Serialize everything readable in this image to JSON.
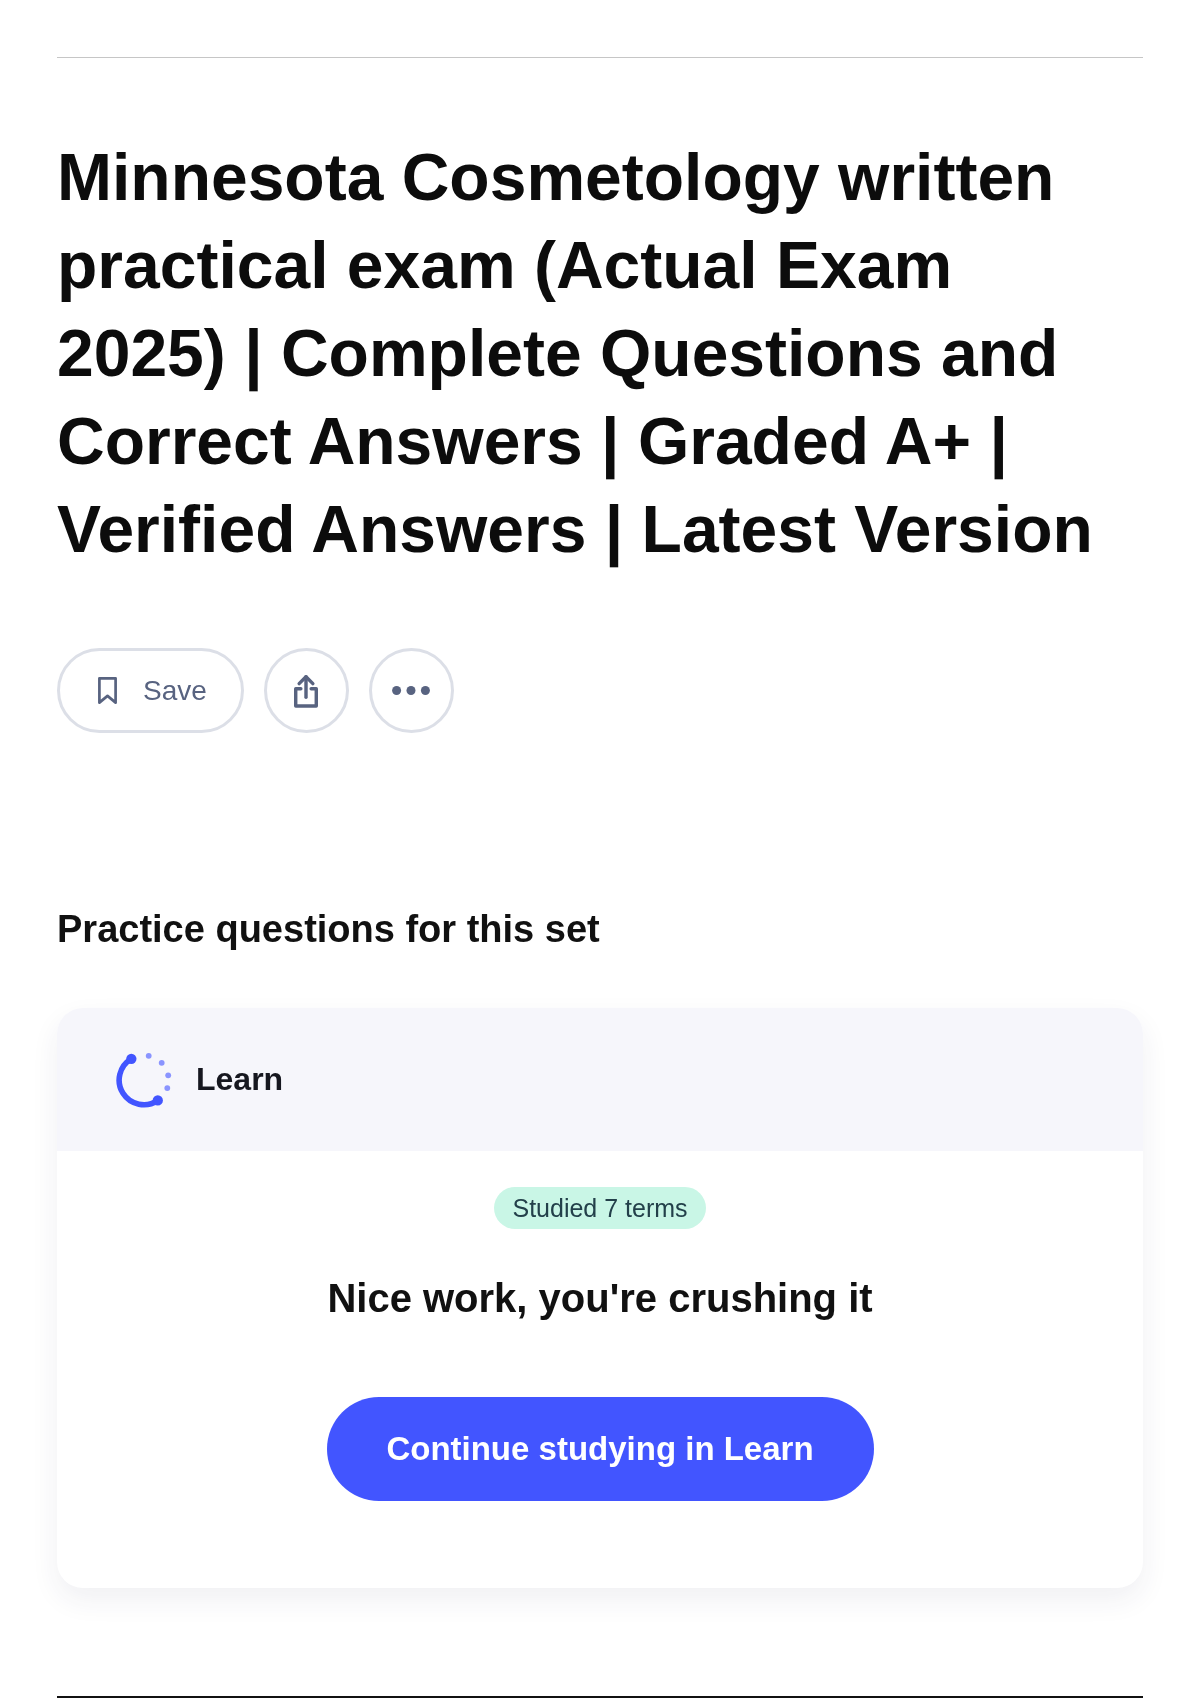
{
  "title": "Minnesota Cosmetology written practical exam (Actual Exam 2025) | Complete Questions and Correct Answers | Graded A+ | Verified Answers | Latest Version",
  "actions": [
    {
      "kind": "save",
      "label": "Save"
    },
    {
      "kind": "share"
    },
    {
      "kind": "more"
    }
  ],
  "practice": {
    "heading": "Practice questions for this set",
    "card": {
      "mode": "Learn",
      "badge": "Studied 7 terms",
      "message": "Nice work, you're crushing it",
      "button": "Continue studying in Learn"
    }
  }
}
